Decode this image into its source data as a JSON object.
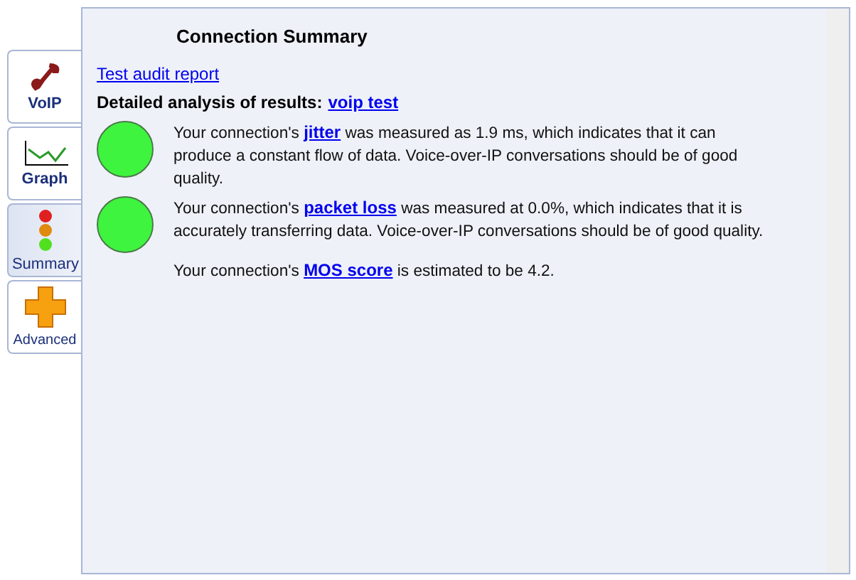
{
  "tabs": [
    {
      "label": "VoIP",
      "selected": false
    },
    {
      "label": "Graph",
      "selected": false
    },
    {
      "label": "Summary",
      "selected": true
    },
    {
      "label": "Advanced",
      "selected": false
    }
  ],
  "panel": {
    "title": "Connection Summary",
    "report_link": "Test audit report",
    "analysis_label": "Detailed analysis of results:",
    "analysis_link": "voip test",
    "results": [
      {
        "kind": "light",
        "before": "Your connection's",
        "link": "jitter",
        "after": "was measured as 1.9 ms, which indicates that it can produce a constant flow of data. Voice-over-IP conversations should be of good quality."
      },
      {
        "kind": "light",
        "before": "Your connection's",
        "link": "packet loss",
        "after": "was measured at 0.0%, which indicates that it is accurately transferring data. Voice-over-IP conversations should be of good quality."
      },
      {
        "kind": "plain",
        "before": "Your connection's",
        "link": "MOS score",
        "after": "is estimated to be 4.2."
      }
    ]
  }
}
